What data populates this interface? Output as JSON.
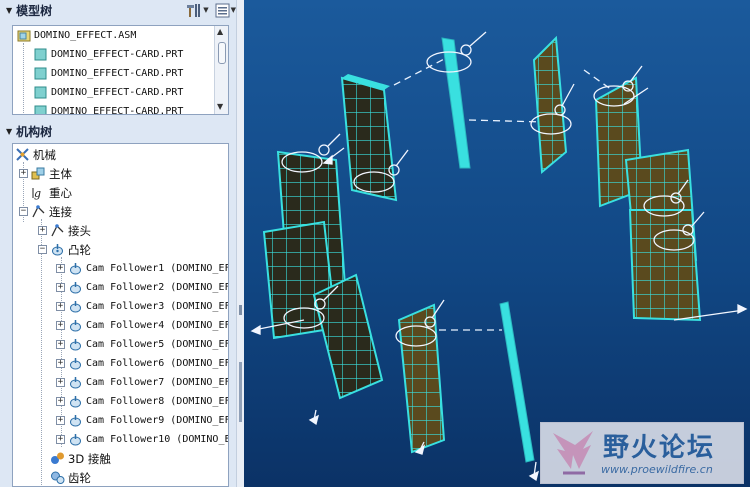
{
  "model_tree": {
    "title": "模型树",
    "items": [
      {
        "label": "DOMINO_EFFECT.ASM"
      },
      {
        "label": "DOMINO_EFFECT-CARD.PRT"
      },
      {
        "label": "DOMINO_EFFECT-CARD.PRT"
      },
      {
        "label": "DOMINO_EFFECT-CARD.PRT"
      },
      {
        "label": "DOMINO_EFFECT-CARD.PRT"
      }
    ]
  },
  "mech_tree": {
    "title": "机构树",
    "items": [
      {
        "label": "机械"
      },
      {
        "label": "主体"
      },
      {
        "label": "重心"
      },
      {
        "label": "连接"
      },
      {
        "label": "接头"
      },
      {
        "label": "凸轮"
      },
      {
        "label": "Cam Follower1  (DOMINO_EF"
      },
      {
        "label": "Cam Follower2  (DOMINO_EF"
      },
      {
        "label": "Cam Follower3  (DOMINO_EF"
      },
      {
        "label": "Cam Follower4  (DOMINO_EF"
      },
      {
        "label": "Cam Follower5  (DOMINO_EF"
      },
      {
        "label": "Cam Follower6  (DOMINO_EF"
      },
      {
        "label": "Cam Follower7  (DOMINO_EF"
      },
      {
        "label": "Cam Follower8  (DOMINO_EF"
      },
      {
        "label": "Cam Follower9  (DOMINO_EF"
      },
      {
        "label": "Cam Follower10  (DOMINO_E"
      },
      {
        "label": "3D 接触"
      },
      {
        "label": "齿轮"
      }
    ]
  },
  "icons": {
    "model_toolbar_settings": "hammer-settings-icon",
    "model_toolbar_show": "show-list-icon"
  },
  "watermark": {
    "title": "野火论坛",
    "url": "www.proewildfire.cn"
  }
}
